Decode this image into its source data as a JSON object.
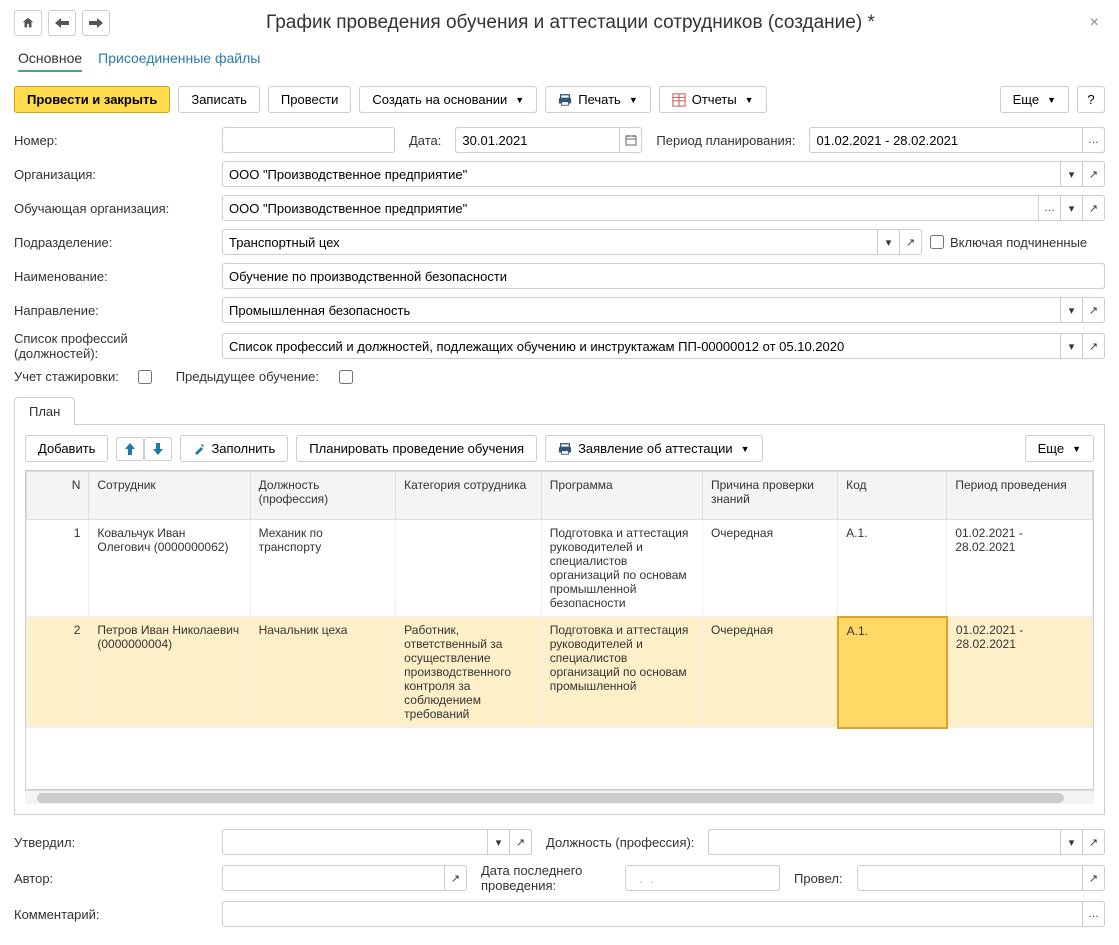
{
  "header": {
    "title": "График проведения обучения и аттестации сотрудников (создание) *"
  },
  "navTabs": {
    "main": "Основное",
    "attached": "Присоединенные файлы"
  },
  "toolbar": {
    "postClose": "Провести и закрыть",
    "write": "Записать",
    "post": "Провести",
    "createBased": "Создать на основании",
    "print": "Печать",
    "reports": "Отчеты",
    "more": "Еще",
    "help": "?"
  },
  "form": {
    "numberLabel": "Номер:",
    "numberValue": "",
    "dateLabel": "Дата:",
    "dateValue": "30.01.2021",
    "planPeriodLabel": "Период планирования:",
    "planPeriodValue": "01.02.2021 - 28.02.2021",
    "orgLabel": "Организация:",
    "orgValue": "ООО \"Производственное предприятие\"",
    "trainOrgLabel": "Обучающая организация:",
    "trainOrgValue": "ООО \"Производственное предприятие\"",
    "deptLabel": "Подразделение:",
    "deptValue": "Транспортный цех",
    "includeSubLabel": "Включая подчиненные",
    "nameLabel": "Наименование:",
    "nameValue": "Обучение по производственной безопасности",
    "directionLabel": "Направление:",
    "directionValue": "Промышленная безопасность",
    "profListLabel": "Список профессий (должностей):",
    "profListValue": "Список профессий и должностей, подлежащих обучению и инструктажам ПП-00000012 от 05.10.2020",
    "internshipLabel": "Учет стажировки:",
    "prevTrainingLabel": "Предыдущее обучение:"
  },
  "sectionTab": "План",
  "gridToolbar": {
    "add": "Добавить",
    "fill": "Заполнить",
    "plan": "Планировать проведение обучения",
    "statement": "Заявление об аттестации",
    "more": "Еще"
  },
  "gridHeaders": {
    "n": "N",
    "employee": "Сотрудник",
    "position": "Должность (профессия)",
    "category": "Категория сотрудника",
    "program": "Программа",
    "reason": "Причина проверки знаний",
    "code": "Код",
    "period": "Период проведения"
  },
  "gridRows": [
    {
      "n": "1",
      "employee": "Ковальчук Иван Олегович (0000000062)",
      "position": "Механик по транспорту",
      "category": "",
      "program": "Подготовка и аттестация руководителей и специалистов организаций по основам промышленной безопасности",
      "reason": "Очередная",
      "code": "А.1.",
      "period": "01.02.2021 - 28.02.2021"
    },
    {
      "n": "2",
      "employee": "Петров Иван Николаевич (0000000004)",
      "position": "Начальник цеха",
      "category": "Работник, ответственный за осуществление производственного контроля за соблюдением требований",
      "program": "Подготовка и аттестация руководителей и специалистов организаций по основам промышленной",
      "reason": "Очередная",
      "code": "А.1.",
      "period": "01.02.2021 - 28.02.2021"
    }
  ],
  "bottomForm": {
    "approvedLabel": "Утвердил:",
    "positionLabel": "Должность (профессия):",
    "authorLabel": "Автор:",
    "lastDateLabel": "Дата последнего проведения:",
    "lastDateValue": "  .  .    ",
    "conductedLabel": "Провел:",
    "commentLabel": "Комментарий:"
  }
}
